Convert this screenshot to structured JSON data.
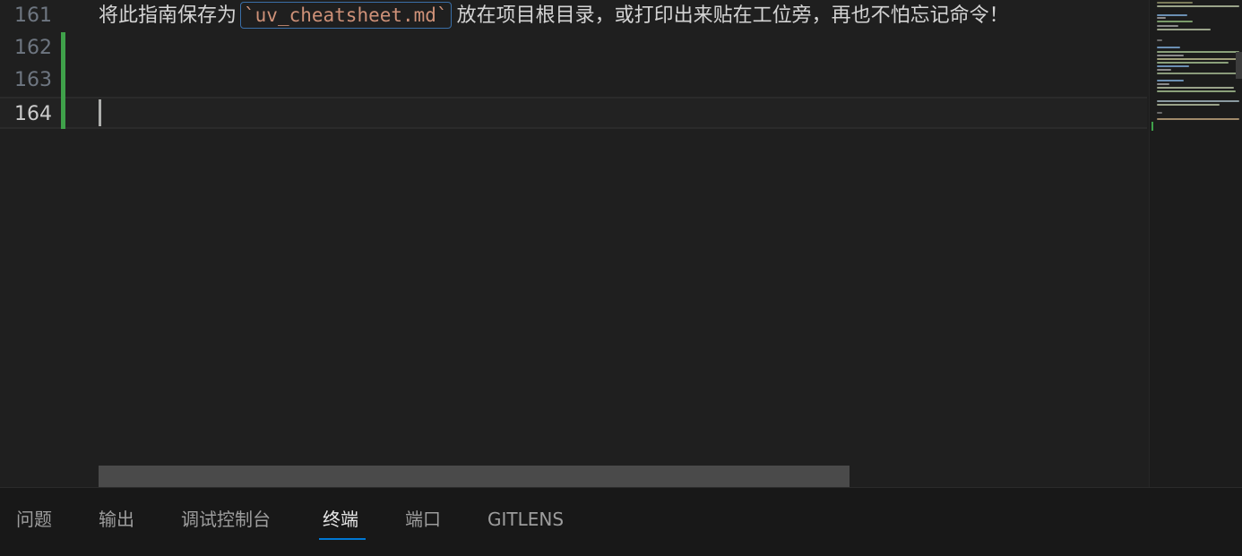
{
  "editor": {
    "lines": [
      {
        "number": "161",
        "text_before": "将此指南保存为",
        "code": "`uv_cheatsheet.md`",
        "text_after": "放在项目根目录，或打印出来贴在工位旁，再也不怕忘记命令！"
      },
      {
        "number": "162"
      },
      {
        "number": "163"
      },
      {
        "number": "164"
      }
    ]
  },
  "panel": {
    "tabs": [
      {
        "label": "问题"
      },
      {
        "label": "输出"
      },
      {
        "label": "调试控制台"
      },
      {
        "label": "终端"
      },
      {
        "label": "端口"
      },
      {
        "label": "GITLENS"
      }
    ],
    "active_tab": "终端"
  },
  "colors": {
    "background": "#1f1f1f",
    "git_added": "#3fa14a",
    "accent": "#0078d4",
    "inline_code": "#ce9178"
  }
}
